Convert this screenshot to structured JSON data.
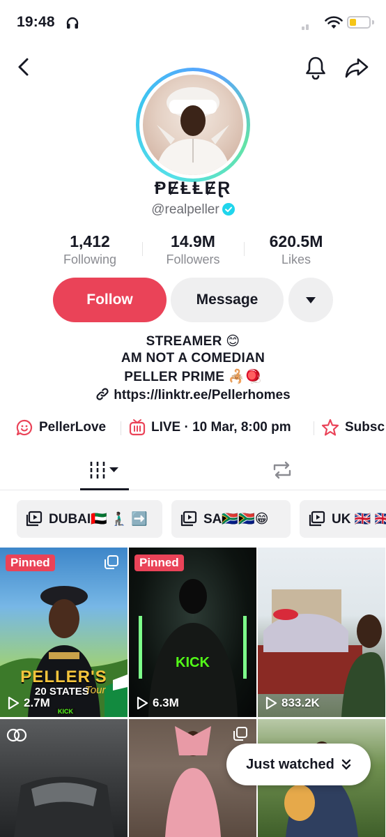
{
  "status_bar": {
    "time": "19:48"
  },
  "profile": {
    "display_name": "ⱣɆⱠⱠɆⱤ",
    "username": "@realpeller",
    "stats": [
      {
        "value": "1,412",
        "label": "Following"
      },
      {
        "value": "14.9M",
        "label": "Followers"
      },
      {
        "value": "620.5M",
        "label": "Likes"
      }
    ],
    "follow_label": "Follow",
    "message_label": "Message",
    "bio": [
      "STREAMER 😊",
      "AM NOT A COMEDIAN",
      "PELLER PRIME 🦂🪀"
    ],
    "link": "https://linktr.ee/Pellerhomes",
    "chips": [
      "PellerLove",
      "LIVE · 10 Mar, 8:00 pm",
      "Subsc"
    ]
  },
  "playlists": [
    "DUBAI🇦🇪 🧎🏿‍♂️ ➡️",
    "SA🇿🇦🇿🇦😁",
    "UK 🇬🇧 🇬🇧"
  ],
  "videos": [
    {
      "pinned": "Pinned",
      "views": "2.7M",
      "poster_text": "PELLER'S",
      "poster_sub": "20 STATES",
      "poster_tour": "Tour",
      "poster_tag": "KICK"
    },
    {
      "pinned": "Pinned",
      "views": "6.3M",
      "hoodie_text": "KICK"
    },
    {
      "views": "833.2K"
    },
    {},
    {},
    {}
  ],
  "just_watched_label": "Just watched",
  "colors": {
    "accent": "#ea4358",
    "verified": "#20d5ec",
    "kick_green": "#53fc18"
  }
}
